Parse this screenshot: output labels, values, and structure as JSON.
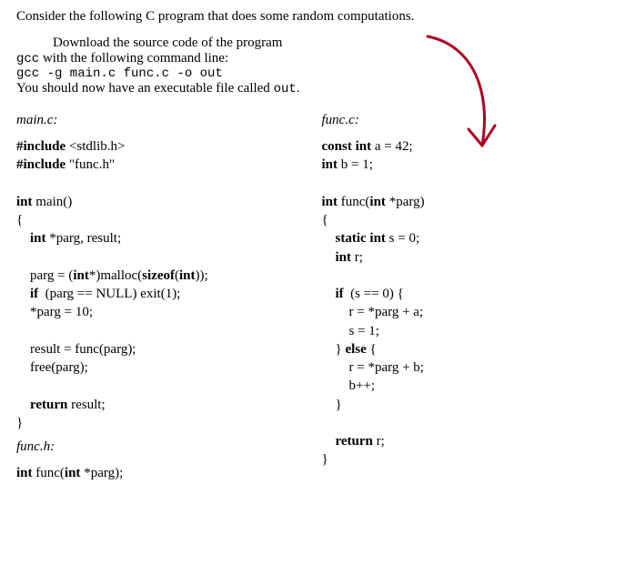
{
  "intro": "Consider the following C program that does some random computations.",
  "instructions": {
    "download": "Download the source code of the program",
    "gcc_prefix": "gcc",
    "gcc_rest": " with the following command line:",
    "command": "gcc -g main.c func.c -o out",
    "result_prefix": "You should now have an executable file called ",
    "out_name": "out",
    "result_suffix": "."
  },
  "left": {
    "main_label": "main.c:",
    "funch_label": "func.h:",
    "main_code_html": "<span class=\"kw\">#include</span> &lt;stdlib.h&gt;\n<span class=\"kw\">#include</span> \"func.h\"\n\n<span class=\"kw\">int</span> main()\n{\n    <span class=\"kw\">int</span> *parg, result;\n\n    parg = (<span class=\"kw\">int</span>*)malloc(<span class=\"kw\">sizeof</span>(<span class=\"kw\">int</span>));\n    <span class=\"kw\">if</span>  (parg == NULL) exit(1);\n    *parg = 10;\n\n    result = func(parg);\n    free(parg);\n\n    <span class=\"kw\">return</span> result;\n}",
    "funch_code_html": "<span class=\"kw\">int</span> func(<span class=\"kw\">int</span> *parg);"
  },
  "right": {
    "func_label": "func.c:",
    "func_code_html": "<span class=\"kw\">const int</span> a = 42;\n<span class=\"kw\">int</span> b = 1;\n\n<span class=\"kw\">int</span> func(<span class=\"kw\">int</span> *parg)\n{\n    <span class=\"kw\">static int</span> s = 0;\n    <span class=\"kw\">int</span> r;\n\n    <span class=\"kw\">if</span>  (s == 0) {\n        r = *parg + a;\n        s = 1;\n    } <span class=\"kw\">else</span> {\n        r = *parg + b;\n        b++;\n    }\n\n    <span class=\"kw\">return</span> r;\n}"
  }
}
